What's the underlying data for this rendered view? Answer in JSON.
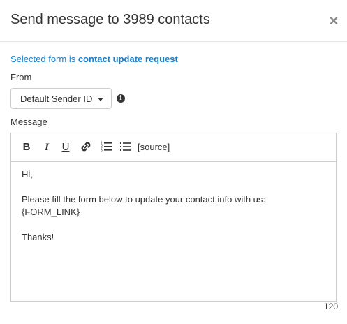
{
  "header": {
    "title": "Send message to 3989 contacts",
    "close_label": "×"
  },
  "form_info": {
    "prefix": "Selected form is ",
    "form_name": "contact update request"
  },
  "from": {
    "label": "From",
    "selected_sender": "Default Sender ID",
    "info_icon": "info-circle-icon"
  },
  "message": {
    "label": "Message",
    "toolbar": {
      "bold_label": "B",
      "italic_label": "I",
      "underline_label": "U",
      "link_icon": "link-icon",
      "ordered_list_icon": "ordered-list-icon",
      "unordered_list_icon": "unordered-list-icon",
      "source_label": "[source]"
    },
    "body_lines": [
      "Hi,",
      "",
      "Please fill the form below to update your contact info with us:",
      "{FORM_LINK}",
      "",
      "Thanks!"
    ],
    "char_count": "120"
  }
}
